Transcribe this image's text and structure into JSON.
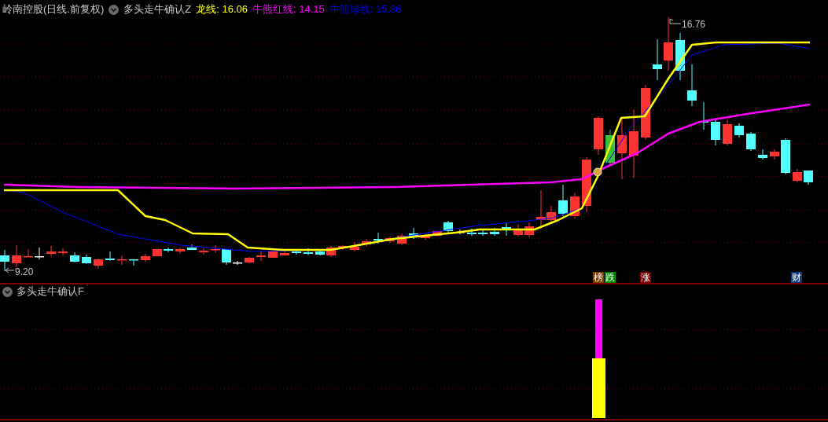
{
  "header": {
    "stock_title": "岭南控股(日线.前复权)",
    "indicator_name": "多头走牛确认Z",
    "readings": [
      {
        "label": "龙线:",
        "value": "16.06",
        "color": "#ffff00"
      },
      {
        "label": "牛熊红线:",
        "value": "14.15",
        "color": "#ff00ff"
      },
      {
        "label": "牛熊绿线:",
        "value": "15.86",
        "color": "#0000ff"
      }
    ]
  },
  "price_labels": {
    "high": "16.76",
    "low": "9.20"
  },
  "signal_badges": [
    {
      "text": "榜",
      "color": "#7a4000"
    },
    {
      "text": "跌",
      "color": "#008a00"
    },
    {
      "text": "涨",
      "color": "#800000"
    },
    {
      "text": "财",
      "color": "#0a3a78"
    }
  ],
  "lower_panel": {
    "title": "多头走牛确认F"
  }
}
